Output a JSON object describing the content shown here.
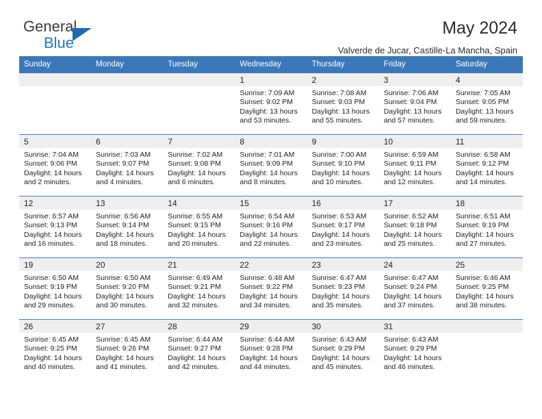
{
  "brand": {
    "name_part1": "General",
    "name_part2": "Blue",
    "logo_icon": "triangle-logo-icon",
    "accent_color": "#2079c5"
  },
  "header": {
    "title": "May 2024",
    "subtitle": "Valverde de Jucar, Castille-La Mancha, Spain"
  },
  "calendar": {
    "header_bg": "#3b78ba",
    "daynum_bg": "#efefef",
    "weekday_headers": [
      "Sunday",
      "Monday",
      "Tuesday",
      "Wednesday",
      "Thursday",
      "Friday",
      "Saturday"
    ],
    "weeks": [
      [
        {
          "day": "",
          "lines": []
        },
        {
          "day": "",
          "lines": []
        },
        {
          "day": "",
          "lines": []
        },
        {
          "day": "1",
          "lines": [
            "Sunrise: 7:09 AM",
            "Sunset: 9:02 PM",
            "Daylight: 13 hours",
            "and 53 minutes."
          ]
        },
        {
          "day": "2",
          "lines": [
            "Sunrise: 7:08 AM",
            "Sunset: 9:03 PM",
            "Daylight: 13 hours",
            "and 55 minutes."
          ]
        },
        {
          "day": "3",
          "lines": [
            "Sunrise: 7:06 AM",
            "Sunset: 9:04 PM",
            "Daylight: 13 hours",
            "and 57 minutes."
          ]
        },
        {
          "day": "4",
          "lines": [
            "Sunrise: 7:05 AM",
            "Sunset: 9:05 PM",
            "Daylight: 13 hours",
            "and 59 minutes."
          ]
        }
      ],
      [
        {
          "day": "5",
          "lines": [
            "Sunrise: 7:04 AM",
            "Sunset: 9:06 PM",
            "Daylight: 14 hours",
            "and 2 minutes."
          ]
        },
        {
          "day": "6",
          "lines": [
            "Sunrise: 7:03 AM",
            "Sunset: 9:07 PM",
            "Daylight: 14 hours",
            "and 4 minutes."
          ]
        },
        {
          "day": "7",
          "lines": [
            "Sunrise: 7:02 AM",
            "Sunset: 9:08 PM",
            "Daylight: 14 hours",
            "and 6 minutes."
          ]
        },
        {
          "day": "8",
          "lines": [
            "Sunrise: 7:01 AM",
            "Sunset: 9:09 PM",
            "Daylight: 14 hours",
            "and 8 minutes."
          ]
        },
        {
          "day": "9",
          "lines": [
            "Sunrise: 7:00 AM",
            "Sunset: 9:10 PM",
            "Daylight: 14 hours",
            "and 10 minutes."
          ]
        },
        {
          "day": "10",
          "lines": [
            "Sunrise: 6:59 AM",
            "Sunset: 9:11 PM",
            "Daylight: 14 hours",
            "and 12 minutes."
          ]
        },
        {
          "day": "11",
          "lines": [
            "Sunrise: 6:58 AM",
            "Sunset: 9:12 PM",
            "Daylight: 14 hours",
            "and 14 minutes."
          ]
        }
      ],
      [
        {
          "day": "12",
          "lines": [
            "Sunrise: 6:57 AM",
            "Sunset: 9:13 PM",
            "Daylight: 14 hours",
            "and 16 minutes."
          ]
        },
        {
          "day": "13",
          "lines": [
            "Sunrise: 6:56 AM",
            "Sunset: 9:14 PM",
            "Daylight: 14 hours",
            "and 18 minutes."
          ]
        },
        {
          "day": "14",
          "lines": [
            "Sunrise: 6:55 AM",
            "Sunset: 9:15 PM",
            "Daylight: 14 hours",
            "and 20 minutes."
          ]
        },
        {
          "day": "15",
          "lines": [
            "Sunrise: 6:54 AM",
            "Sunset: 9:16 PM",
            "Daylight: 14 hours",
            "and 22 minutes."
          ]
        },
        {
          "day": "16",
          "lines": [
            "Sunrise: 6:53 AM",
            "Sunset: 9:17 PM",
            "Daylight: 14 hours",
            "and 23 minutes."
          ]
        },
        {
          "day": "17",
          "lines": [
            "Sunrise: 6:52 AM",
            "Sunset: 9:18 PM",
            "Daylight: 14 hours",
            "and 25 minutes."
          ]
        },
        {
          "day": "18",
          "lines": [
            "Sunrise: 6:51 AM",
            "Sunset: 9:19 PM",
            "Daylight: 14 hours",
            "and 27 minutes."
          ]
        }
      ],
      [
        {
          "day": "19",
          "lines": [
            "Sunrise: 6:50 AM",
            "Sunset: 9:19 PM",
            "Daylight: 14 hours",
            "and 29 minutes."
          ]
        },
        {
          "day": "20",
          "lines": [
            "Sunrise: 6:50 AM",
            "Sunset: 9:20 PM",
            "Daylight: 14 hours",
            "and 30 minutes."
          ]
        },
        {
          "day": "21",
          "lines": [
            "Sunrise: 6:49 AM",
            "Sunset: 9:21 PM",
            "Daylight: 14 hours",
            "and 32 minutes."
          ]
        },
        {
          "day": "22",
          "lines": [
            "Sunrise: 6:48 AM",
            "Sunset: 9:22 PM",
            "Daylight: 14 hours",
            "and 34 minutes."
          ]
        },
        {
          "day": "23",
          "lines": [
            "Sunrise: 6:47 AM",
            "Sunset: 9:23 PM",
            "Daylight: 14 hours",
            "and 35 minutes."
          ]
        },
        {
          "day": "24",
          "lines": [
            "Sunrise: 6:47 AM",
            "Sunset: 9:24 PM",
            "Daylight: 14 hours",
            "and 37 minutes."
          ]
        },
        {
          "day": "25",
          "lines": [
            "Sunrise: 6:46 AM",
            "Sunset: 9:25 PM",
            "Daylight: 14 hours",
            "and 38 minutes."
          ]
        }
      ],
      [
        {
          "day": "26",
          "lines": [
            "Sunrise: 6:45 AM",
            "Sunset: 9:25 PM",
            "Daylight: 14 hours",
            "and 40 minutes."
          ]
        },
        {
          "day": "27",
          "lines": [
            "Sunrise: 6:45 AM",
            "Sunset: 9:26 PM",
            "Daylight: 14 hours",
            "and 41 minutes."
          ]
        },
        {
          "day": "28",
          "lines": [
            "Sunrise: 6:44 AM",
            "Sunset: 9:27 PM",
            "Daylight: 14 hours",
            "and 42 minutes."
          ]
        },
        {
          "day": "29",
          "lines": [
            "Sunrise: 6:44 AM",
            "Sunset: 9:28 PM",
            "Daylight: 14 hours",
            "and 44 minutes."
          ]
        },
        {
          "day": "30",
          "lines": [
            "Sunrise: 6:43 AM",
            "Sunset: 9:29 PM",
            "Daylight: 14 hours",
            "and 45 minutes."
          ]
        },
        {
          "day": "31",
          "lines": [
            "Sunrise: 6:43 AM",
            "Sunset: 9:29 PM",
            "Daylight: 14 hours",
            "and 46 minutes."
          ]
        },
        {
          "day": "",
          "lines": []
        }
      ]
    ]
  }
}
